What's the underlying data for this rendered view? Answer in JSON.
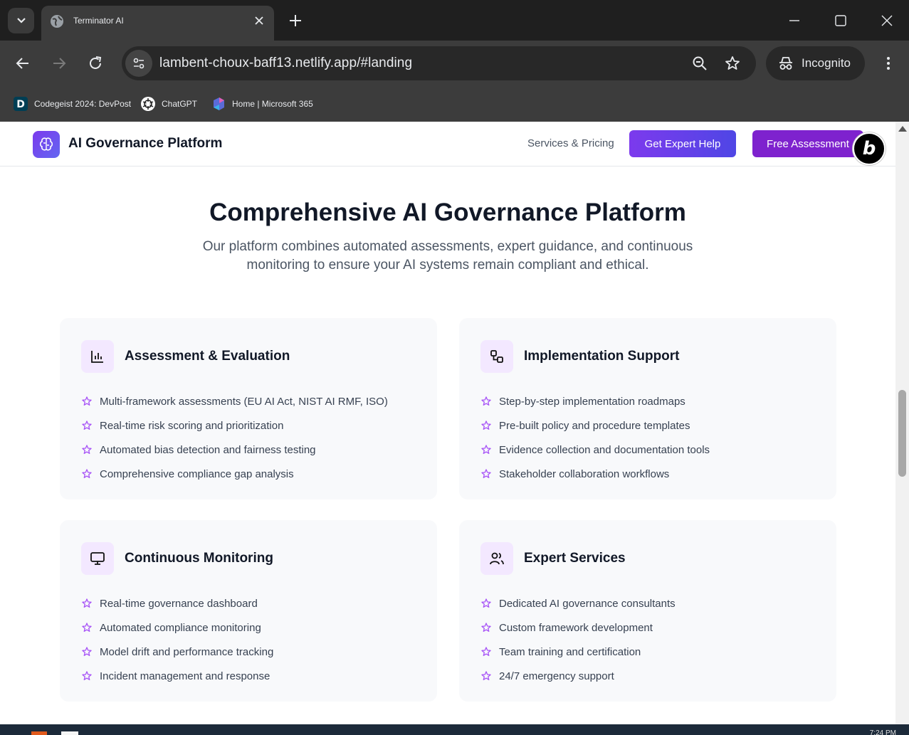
{
  "browser": {
    "tab_title": "Terminator AI",
    "url": "lambent-choux-baff13.netlify.app/#landing",
    "incognito_label": "Incognito",
    "bookmarks": [
      {
        "label": "Codegeist 2024: DevPost",
        "icon": "devpost-icon"
      },
      {
        "label": "ChatGPT",
        "icon": "chatgpt-icon"
      },
      {
        "label": "Home | Microsoft 365",
        "icon": "microsoft365-icon"
      }
    ]
  },
  "navbar": {
    "brand": "AI Governance Platform",
    "services_link": "Services & Pricing",
    "expert_button": "Get Expert Help",
    "assessment_button": "Free Assessment",
    "badge_letter": "b"
  },
  "hero": {
    "title": "Comprehensive AI Governance Platform",
    "subtitle": "Our platform combines automated assessments, expert guidance, and continuous monitoring to ensure your AI systems remain compliant and ethical."
  },
  "cards": [
    {
      "title": "Assessment & Evaluation",
      "icon": "bar-chart-icon",
      "features": [
        "Multi-framework assessments (EU AI Act, NIST AI RMF, ISO)",
        "Real-time risk scoring and prioritization",
        "Automated bias detection and fairness testing",
        "Comprehensive compliance gap analysis"
      ]
    },
    {
      "title": "Implementation Support",
      "icon": "workflow-icon",
      "features": [
        "Step-by-step implementation roadmaps",
        "Pre-built policy and procedure templates",
        "Evidence collection and documentation tools",
        "Stakeholder collaboration workflows"
      ]
    },
    {
      "title": "Continuous Monitoring",
      "icon": "monitor-icon",
      "features": [
        "Real-time governance dashboard",
        "Automated compliance monitoring",
        "Model drift and performance tracking",
        "Incident management and response"
      ]
    },
    {
      "title": "Expert Services",
      "icon": "users-icon",
      "features": [
        "Dedicated AI governance consultants",
        "Custom framework development",
        "Team training and certification",
        "24/7 emergency support"
      ]
    }
  ],
  "colors": {
    "accent": "#7e22ce",
    "icon_bg": "#f3e8ff",
    "star": "#a855f7",
    "card_bg": "#f8f9fb"
  },
  "taskbar": {
    "clock": "7:24 PM"
  }
}
